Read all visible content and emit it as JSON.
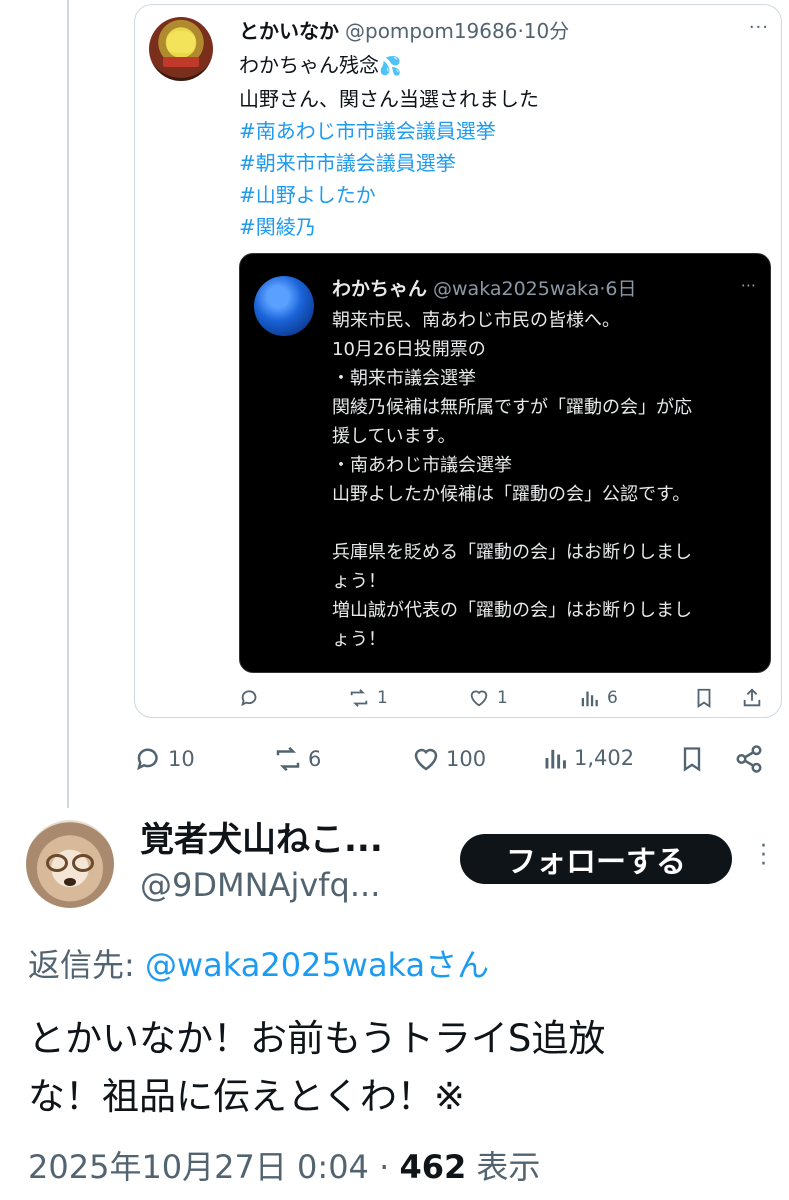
{
  "quoted_tweet": {
    "name": "とかいなか",
    "handle": "@pompom19686",
    "time": "·10分",
    "more": "···",
    "line1": "わかちゃん残念",
    "sweat_emoji": "💦",
    "line2": "山野さん、関さん当選されました",
    "hashtags": [
      "#南あわじ市市議会議員選挙",
      "#朝来市市議会議員選挙",
      "#山野よしたか",
      "#関綾乃"
    ],
    "inner": {
      "name": "わかちゃん",
      "handle": "@waka2025waka",
      "time": "·6日",
      "more": "···",
      "lines": [
        "朝来市民、南あわじ市民の皆様へ。",
        "10月26日投開票の",
        "・朝来市議会選挙",
        "関綾乃候補は無所属ですが「躍動の会」が応",
        "援しています。",
        "・南あわじ市議会選挙",
        "山野よしたか候補は「躍動の会」公認です。",
        "",
        "兵庫県を貶める「躍動の会」はお断りしまし",
        "ょう！",
        "増山誠が代表の「躍動の会」はお断りしまし",
        "ょう！"
      ]
    },
    "actions": {
      "reposts": "1",
      "likes": "1",
      "views": "6"
    }
  },
  "main_actions": {
    "replies": "10",
    "reposts": "6",
    "likes": "100",
    "views": "1,402"
  },
  "reply_tweet": {
    "name": "覚者犬山ねこ...",
    "handle": "@9DMNAjvfq...",
    "follow_label": "フォローする",
    "reply_to_label": "返信先:",
    "reply_to_mention": "@waka2025wakaさん",
    "text_line1": "とかいなか！お前もうトライS追放",
    "text_line2": "な！祖品に伝えとくわ！※",
    "timestamp": "2025年10月27日 0:04 · ",
    "views_count": "462",
    "views_label": " 表示"
  },
  "colors": {
    "accent": "#1d9bf0",
    "text": "#0f1419",
    "muted": "#536471",
    "border": "#cfd9de"
  },
  "icons": [
    "reply-icon",
    "repost-icon",
    "like-icon",
    "views-icon",
    "bookmark-icon",
    "share-icon",
    "more-icon"
  ]
}
